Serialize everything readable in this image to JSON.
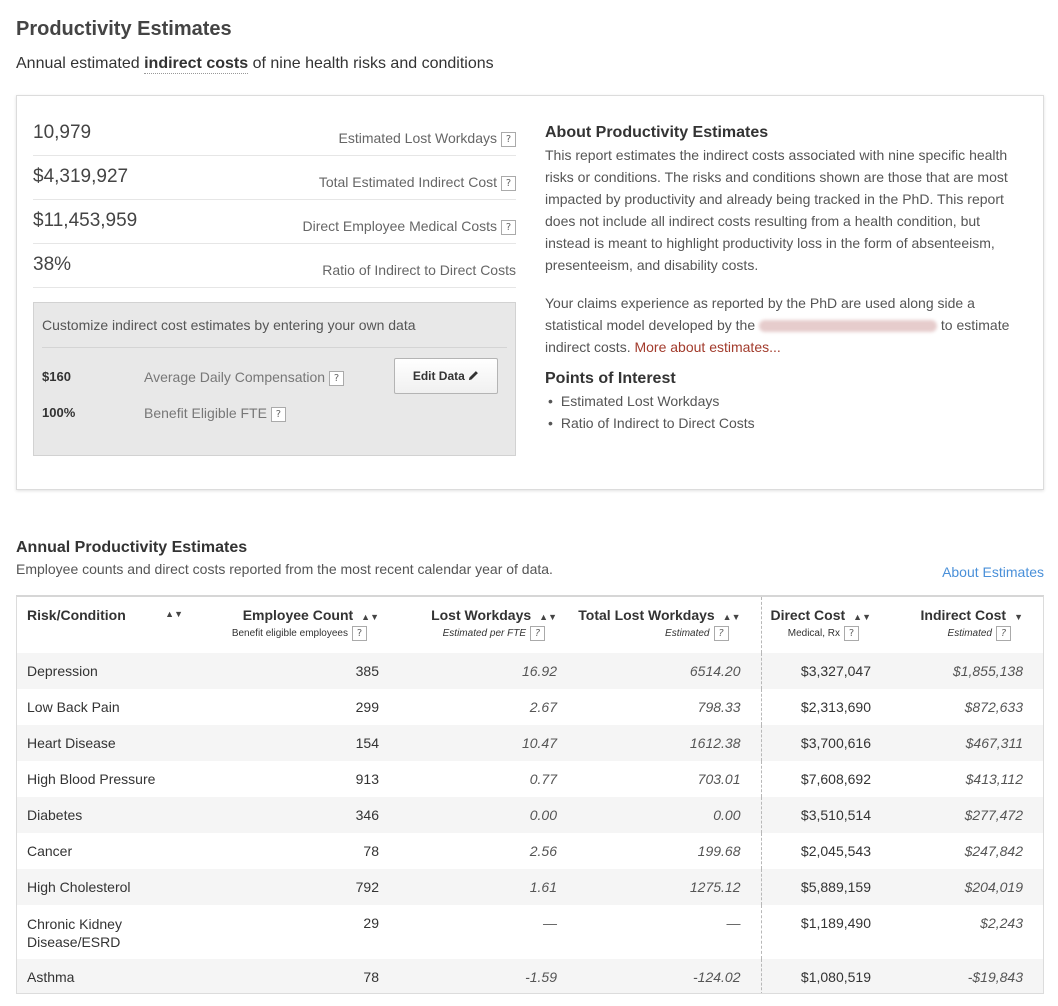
{
  "header": {
    "title": "Productivity Estimates",
    "subtitle_pre": "Annual estimated",
    "subtitle_bold": "indirect costs",
    "subtitle_post": "of nine health risks and conditions"
  },
  "summary": {
    "metrics": [
      {
        "value": "10,979",
        "label": "Estimated Lost Workdays"
      },
      {
        "value": "$4,319,927",
        "label": "Total Estimated Indirect Cost"
      },
      {
        "value": "$11,453,959",
        "label": "Direct Employee Medical Costs"
      },
      {
        "value": "38%",
        "label": "Ratio of Indirect to Direct Costs"
      }
    ],
    "help_glyph": "?",
    "customize": {
      "title": "Customize indirect cost estimates by entering your own data",
      "rows": [
        {
          "value": "$160",
          "label": "Average Daily Compensation"
        },
        {
          "value": "100%",
          "label": "Benefit Eligible FTE"
        }
      ],
      "edit_button": "Edit Data"
    }
  },
  "about": {
    "title": "About Productivity Estimates",
    "paragraph1": "This report estimates the indirect costs associated with nine specific health risks or conditions. The risks and conditions shown are those that are most impacted by productivity and already being tracked in the PhD. This report does not include all indirect costs resulting from a health condition, but instead is meant to highlight productivity loss in the form of absenteeism, presenteeism, and disability costs.",
    "paragraph2_pre": "Your claims experience as reported by the PhD are used along side a statistical model developed by the",
    "paragraph2_post": "to estimate indirect costs.",
    "more_link": "More about estimates...",
    "poi_title": "Points of Interest",
    "poi_items": [
      "Estimated Lost Workdays",
      "Ratio of Indirect to Direct Costs"
    ]
  },
  "table_section": {
    "title": "Annual Productivity Estimates",
    "subtitle": "Employee counts and direct costs reported from the most recent calendar year of data.",
    "about_link": "About Estimates",
    "columns": [
      {
        "label": "Risk/Condition",
        "sub": ""
      },
      {
        "label": "Employee Count",
        "sub": "Benefit eligible employees"
      },
      {
        "label": "Lost Workdays",
        "sub": "Estimated per FTE"
      },
      {
        "label": "Total Lost Workdays",
        "sub": "Estimated"
      },
      {
        "label": "Direct Cost",
        "sub": "Medical, Rx"
      },
      {
        "label": "Indirect Cost",
        "sub": "Estimated"
      }
    ],
    "rows": [
      {
        "condition": "Depression",
        "count": "385",
        "lost": "16.92",
        "total": "6514.20",
        "direct": "$3,327,047",
        "indirect": "$1,855,138"
      },
      {
        "condition": "Low Back Pain",
        "count": "299",
        "lost": "2.67",
        "total": "798.33",
        "direct": "$2,313,690",
        "indirect": "$872,633"
      },
      {
        "condition": "Heart Disease",
        "count": "154",
        "lost": "10.47",
        "total": "1612.38",
        "direct": "$3,700,616",
        "indirect": "$467,311"
      },
      {
        "condition": "High Blood Pressure",
        "count": "913",
        "lost": "0.77",
        "total": "703.01",
        "direct": "$7,608,692",
        "indirect": "$413,112"
      },
      {
        "condition": "Diabetes",
        "count": "346",
        "lost": "0.00",
        "total": "0.00",
        "direct": "$3,510,514",
        "indirect": "$277,472"
      },
      {
        "condition": "Cancer",
        "count": "78",
        "lost": "2.56",
        "total": "199.68",
        "direct": "$2,045,543",
        "indirect": "$247,842"
      },
      {
        "condition": "High Cholesterol",
        "count": "792",
        "lost": "1.61",
        "total": "1275.12",
        "direct": "$5,889,159",
        "indirect": "$204,019"
      },
      {
        "condition": "Chronic Kidney Disease/ESRD",
        "count": "29",
        "lost": "—",
        "total": "—",
        "direct": "$1,189,490",
        "indirect": "$2,243"
      },
      {
        "condition": "Asthma",
        "count": "78",
        "lost": "-1.59",
        "total": "-124.02",
        "direct": "$1,080,519",
        "indirect": "-$19,843"
      }
    ]
  }
}
